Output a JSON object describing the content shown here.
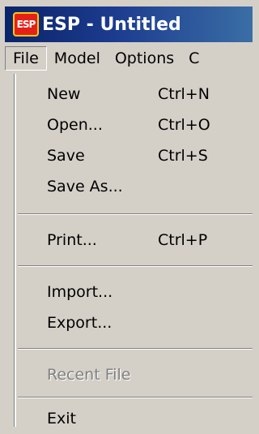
{
  "window": {
    "title": "ESP - Untitled",
    "app_icon_text": "ESP",
    "icon": "esp-app-icon"
  },
  "menubar": {
    "items": [
      {
        "label": "File"
      },
      {
        "label": "Model"
      },
      {
        "label": "Options"
      },
      {
        "label": "C"
      }
    ]
  },
  "file_menu": {
    "items": [
      {
        "label": "New",
        "shortcut": "Ctrl+N",
        "enabled": true
      },
      {
        "label": "Open...",
        "shortcut": "Ctrl+O",
        "enabled": true
      },
      {
        "label": "Save",
        "shortcut": "Ctrl+S",
        "enabled": true
      },
      {
        "label": "Save As...",
        "shortcut": "",
        "enabled": true
      },
      {
        "label": "Print...",
        "shortcut": "Ctrl+P",
        "enabled": true
      },
      {
        "label": "Import...",
        "shortcut": "",
        "enabled": true
      },
      {
        "label": "Export...",
        "shortcut": "",
        "enabled": true
      },
      {
        "label": "Recent File",
        "shortcut": "",
        "enabled": false
      },
      {
        "label": "Exit",
        "shortcut": "",
        "enabled": true
      }
    ]
  },
  "colors": {
    "titlebar_start": "#0a246a",
    "titlebar_end": "#3a6ea5",
    "menu_background": "#d4d0c8",
    "disabled_text": "#808080"
  }
}
